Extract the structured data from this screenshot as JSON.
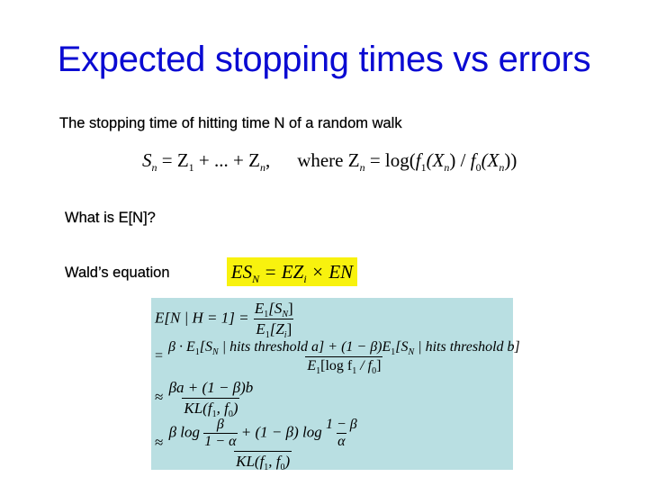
{
  "slide": {
    "title": "Expected stopping times vs errors",
    "colors": {
      "title": "#0a0ad2",
      "highlight": "#f8f20e",
      "formula_box": "#b9dfe2"
    },
    "intro_text": "The stopping time of hitting time N of a random walk",
    "random_walk_equation": {
      "lhs": "S",
      "lhs_sub": "n",
      "eq": " = Z",
      "z1_sub": "1",
      "mid": " + ... + Z",
      "zn_sub": "n",
      "comma": ",",
      "where": "where Z",
      "where_sub": "n",
      "rhs_prefix": " = log(",
      "f1": "f",
      "f1_sub": "1",
      "x_open1": "(X",
      "x1_sub": "n",
      "slash": ") / ",
      "f0": "f",
      "f0_sub": "0",
      "x_open2": "(X",
      "x2_sub": "n",
      "close": "))"
    },
    "question": "What is E[N]?",
    "wald_label": "Wald’s equation",
    "wald_equation": {
      "p1": "ES",
      "p1_sub": "N",
      "p2": " = EZ",
      "p2_sub": "i",
      "p3": " × EN"
    },
    "derivation": {
      "line1_lhs": "E[N | H = 1] =",
      "line1_num": "E₁[Sₙ]",
      "line1_num_a": "E",
      "line1_num_a_sub": "1",
      "line1_num_b": "[S",
      "line1_num_b_sub": "N",
      "line1_num_c": "]",
      "line1_den_a": "E",
      "line1_den_a_sub": "1",
      "line1_den_b": "[Z",
      "line1_den_b_sub": "i",
      "line1_den_c": "]",
      "line2_prefix": "=",
      "line2_num_a": "β · E",
      "line2_num_a_sub": "1",
      "line2_num_b": "[S",
      "line2_num_b_sub": "N",
      "line2_num_c": " | hits threshold a] + (1 − β)E",
      "line2_num_c_sub": "1",
      "line2_num_d": "[S",
      "line2_num_d_sub": "N",
      "line2_num_e": " | hits threshold b]",
      "line2_den_a": "E",
      "line2_den_a_sub": "1",
      "line2_den_b": "[log f",
      "line2_den_b_sub": "1",
      "line2_den_c": " / f",
      "line2_den_c_sub": "0",
      "line2_den_d": "]",
      "line3_prefix": "≈",
      "line3_num": "βa + (1 − β)b",
      "line3_den_a": "KL(f",
      "line3_den_a_sub": "1",
      "line3_den_b": ", f",
      "line3_den_b_sub": "0",
      "line3_den_c": ")",
      "line4_prefix": "≈",
      "line4_num_a": "β log",
      "line4_frac1_num": "β",
      "line4_frac1_den": "1 − α",
      "line4_num_b": " + (1 − β) log",
      "line4_frac2_num": "1 − β",
      "line4_frac2_den": "α",
      "line4_den_a": "KL(f",
      "line4_den_a_sub": "1",
      "line4_den_b": ", f",
      "line4_den_b_sub": "0",
      "line4_den_c": ")"
    }
  }
}
